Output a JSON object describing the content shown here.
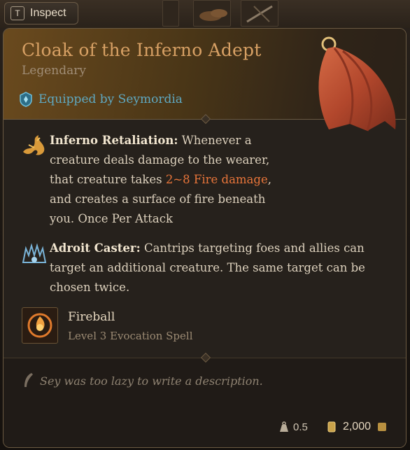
{
  "inspect_tab": {
    "key": "T",
    "label": "Inspect"
  },
  "item": {
    "title": "Cloak of the Inferno Adept",
    "rarity": "Legendary",
    "equipped_by": "Equipped by Seymordia"
  },
  "properties": [
    {
      "name": "Inferno Retaliation:",
      "lines": [
        " Whenever a",
        "creature deals damage to the wearer,",
        "that creature takes ",
        "2~8 Fire damage",
        ",",
        "and creates a surface of fire beneath",
        "you. Once Per Attack"
      ],
      "icon": "flame-retaliation-icon"
    },
    {
      "name": "Adroit Caster:",
      "lines": [
        " Cantrips targeting foes and allies can",
        "target an additional creature. The same target can be",
        "chosen twice."
      ],
      "icon": "arcane-hands-icon"
    }
  ],
  "spell": {
    "name": "Fireball",
    "subtitle": "Level 3 Evocation Spell",
    "icon": "fireball-icon"
  },
  "description": "Sey was too lazy to write a description.",
  "footer": {
    "weight": "0.5",
    "price": "2,000"
  },
  "colors": {
    "title": "#d7a064",
    "fire_damage": "#e8753a",
    "equipped": "#5fa9c2"
  }
}
